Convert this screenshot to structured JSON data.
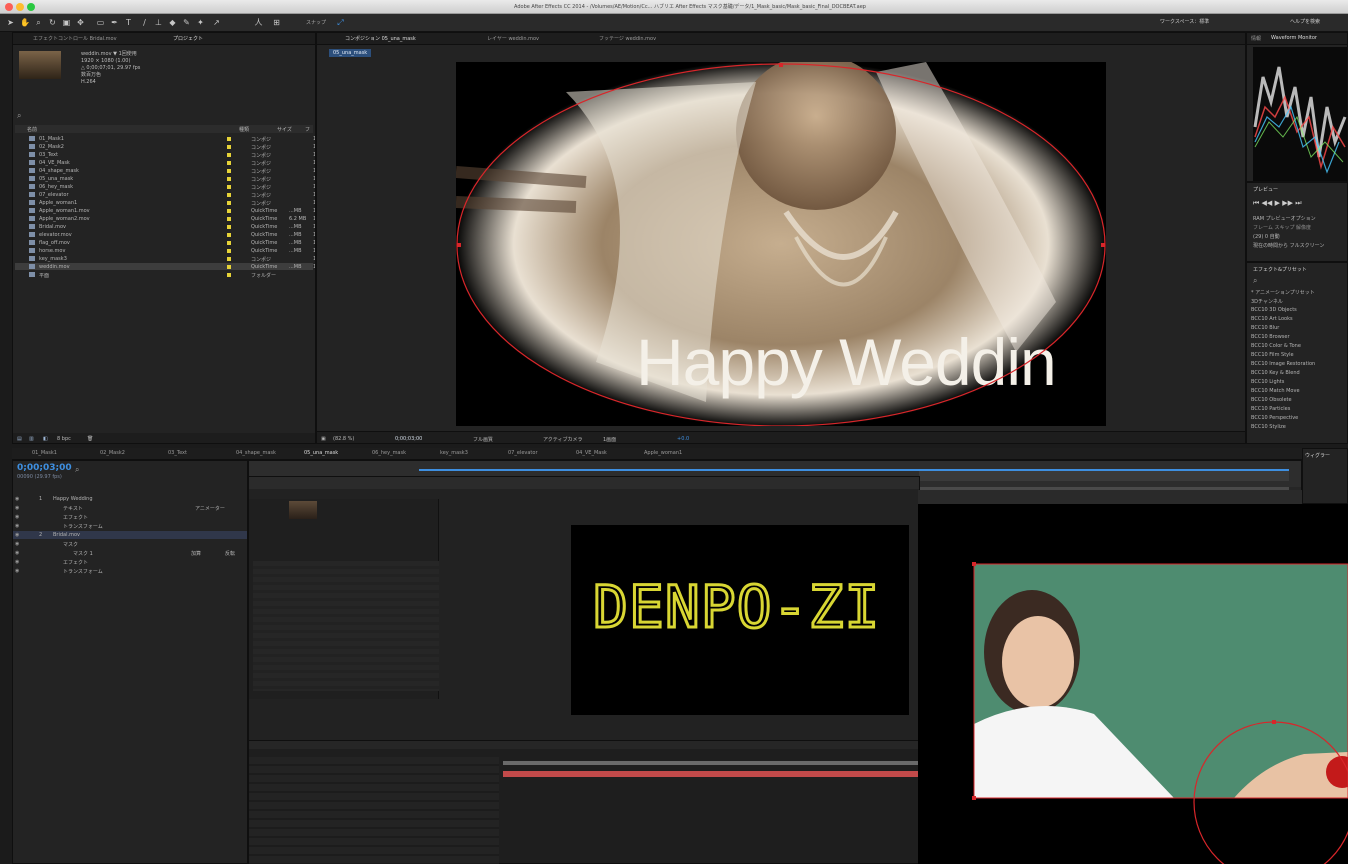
{
  "window": {
    "title": "Adobe After Effects CC 2014 - /Volumes/AE/Motion/Cc... ハブリエ After Effects マスク基礎/データ/1_Mask_basic/Mask_basic_Final_DOCBEAT.aep"
  },
  "toolbar": {
    "snapping_label": "スナップ",
    "workspace_label": "ワークスペース：標準",
    "help_search_placeholder": "ヘルプを検索"
  },
  "project_panel": {
    "tabs": [
      "エフェクトコントロール Bridal.mov",
      "プロジェクト"
    ],
    "info": [
      "weddin.mov ▼ 1回使用",
      "1920 × 1080 (1.00)",
      "△ 0;00;07;01, 29.97 fps",
      "数百万色",
      "H.264"
    ],
    "columns": [
      "名前",
      "種類",
      "サイズ",
      "フ"
    ],
    "items": [
      {
        "name": "01_Mask1",
        "type": "コンポジ",
        "size": "",
        "fr": "1"
      },
      {
        "name": "02_Mask2",
        "type": "コンポジ",
        "size": "",
        "fr": "1"
      },
      {
        "name": "03_Text",
        "type": "コンポジ",
        "size": "",
        "fr": "1"
      },
      {
        "name": "04_VE_Mask",
        "type": "コンポジ",
        "size": "",
        "fr": "1"
      },
      {
        "name": "04_shape_mask",
        "type": "コンポジ",
        "size": "",
        "fr": "1"
      },
      {
        "name": "05_una_mask",
        "type": "コンポジ",
        "size": "",
        "fr": "1"
      },
      {
        "name": "06_hey_mask",
        "type": "コンポジ",
        "size": "",
        "fr": "1"
      },
      {
        "name": "07_elevator",
        "type": "コンポジ",
        "size": "",
        "fr": "1"
      },
      {
        "name": "Apple_woman1",
        "type": "コンポジ",
        "size": "",
        "fr": "1"
      },
      {
        "name": "Apple_woman1.mov",
        "type": "QuickTime",
        "size": "...MB",
        "fr": "1"
      },
      {
        "name": "Apple_woman2.mov",
        "type": "QuickTime",
        "size": "6.2 MB",
        "fr": "1"
      },
      {
        "name": "Bridal.mov",
        "type": "QuickTime",
        "size": "...MB",
        "fr": "1"
      },
      {
        "name": "elevator.mov",
        "type": "QuickTime",
        "size": "...MB",
        "fr": "1"
      },
      {
        "name": "flag_off.mov",
        "type": "QuickTime",
        "size": "...MB",
        "fr": "1"
      },
      {
        "name": "horse.mov",
        "type": "QuickTime",
        "size": "...MB",
        "fr": "1"
      },
      {
        "name": "key_mask3",
        "type": "コンポジ",
        "size": "",
        "fr": "1"
      },
      {
        "name": "weddin.mov",
        "type": "QuickTime",
        "size": "...MB",
        "fr": "1"
      },
      {
        "name": "平面",
        "type": "フォルダー",
        "size": "",
        "fr": ""
      }
    ],
    "footer_bits": "8 bpc"
  },
  "viewer": {
    "tabs": [
      "コンポジション 05_una_mask",
      "レイヤー weddin.mov",
      "フッテージ weddin.mov"
    ],
    "breadcrumb": "05_una_mask",
    "overlay_text": "Happy Weddin",
    "footer": {
      "zoom": "(82.8 %)",
      "timecode": "0;00;03;00",
      "quality": "フル画質",
      "camera": "アクティブカメラ",
      "views": "1画面",
      "offset": "+0.0"
    }
  },
  "right_panel": {
    "tabs": [
      "情報",
      "Waveform Monitor"
    ],
    "preview_title": "プレビュー",
    "preview_rows": [
      "RAM プレビューオプション",
      "フレーム  スキップ  解像度",
      "(29)  0  自動",
      "現在の時間から  フルスクリーン"
    ],
    "effects_title": "エフェクト&プリセット",
    "effects": [
      "* アニメーションプリセット",
      "3Dチャンネル",
      "BCC10 3D Objects",
      "BCC10 Art Looks",
      "BCC10 Blur",
      "BCC10 Browser",
      "BCC10 Color & Tone",
      "BCC10 Film Style",
      "BCC10 Image Restoration",
      "BCC10 Key & Blend",
      "BCC10 Lights",
      "BCC10 Match Move",
      "BCC10 Obsolete",
      "BCC10 Particles",
      "BCC10 Perspective",
      "BCC10 Stylize"
    ]
  },
  "timeline": {
    "tabs": [
      "01_Mask1",
      "02_Mask2",
      "03_Text",
      "04_shape_mask",
      "05_una_mask",
      "06_hey_mask",
      "key_mask3",
      "07_elevator",
      "04_VE_Mask",
      "Apple_woman1"
    ],
    "timecode": "0;00;03;00",
    "fps_label": "00090 (29.97 fps)",
    "layers": [
      {
        "num": "1",
        "name": "Happy Wedding",
        "indent": 0
      },
      {
        "num": "",
        "name": "テキスト",
        "indent": 1
      },
      {
        "num": "",
        "name": "エフェクト",
        "indent": 1
      },
      {
        "num": "",
        "name": "トランスフォーム",
        "indent": 1
      },
      {
        "num": "2",
        "name": "Bridal.mov",
        "indent": 0
      },
      {
        "num": "",
        "name": "マスク",
        "indent": 1
      },
      {
        "num": "",
        "name": "マスク 1",
        "indent": 2
      },
      {
        "num": "",
        "name": "エフェクト",
        "indent": 1
      },
      {
        "num": "",
        "name": "トランスフォーム",
        "indent": 1
      }
    ],
    "mask_mode": "加算",
    "invert_label": "反転",
    "reset_label": "リセット",
    "animator_label": "アニメーター"
  },
  "denpo": {
    "text": "DENPO-ZI"
  },
  "right_lower": {
    "title": "ウィグラー"
  },
  "colors": {
    "accent_blue": "#2f7fd8",
    "mask_red": "#d8262a",
    "label_yellow": "#e6d338",
    "denpo_yellow": "#d8d633"
  }
}
